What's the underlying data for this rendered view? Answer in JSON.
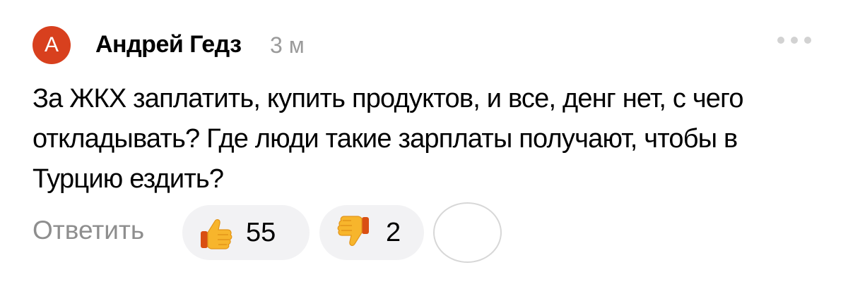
{
  "comment": {
    "avatar_letter": "А",
    "author": "Андрей Гедз",
    "time": "3 м",
    "text": "За ЖКХ заплатить, купить продуктов, и все, денг нет, с чего откладывать? Где люди такие зарплаты получают, чтобы в Турцию ездить?"
  },
  "actions": {
    "reply_label": "Ответить",
    "likes": {
      "icon": "thumbs-up-icon",
      "count": "55"
    },
    "dislikes": {
      "icon": "thumbs-down-icon",
      "count": "2"
    },
    "add_reaction_icon": "add-reaction-icon",
    "more_icon": "more-icon"
  },
  "colors": {
    "avatar": "#d8401e",
    "pill_bg": "#f2f2f4",
    "muted_text": "#8e8e8e"
  }
}
